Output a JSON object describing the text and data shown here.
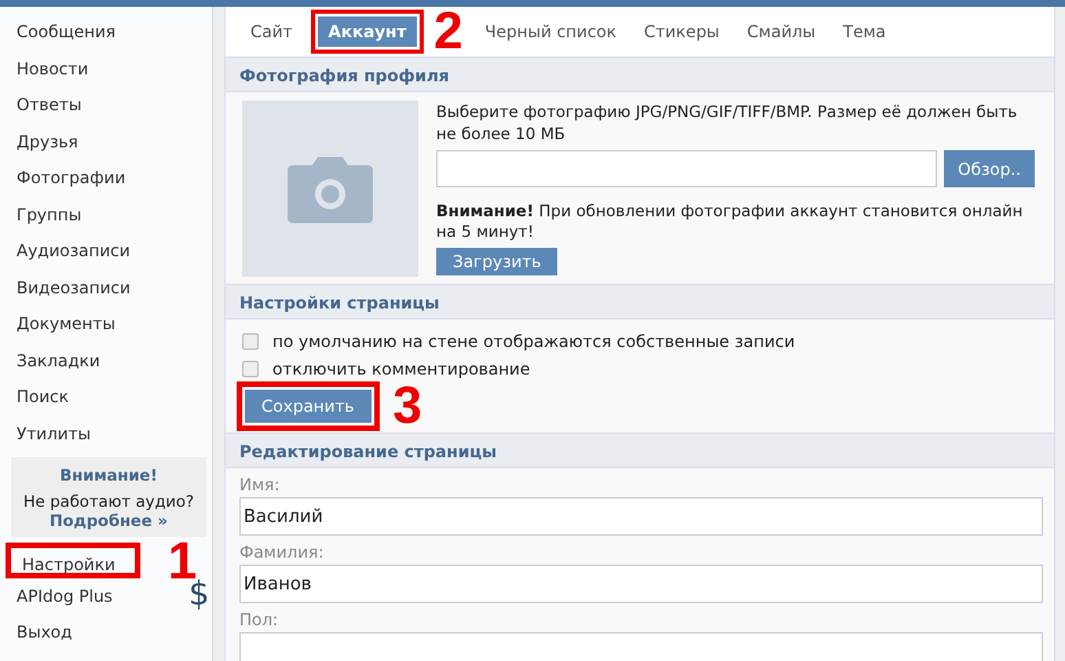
{
  "sidebar": {
    "items": [
      {
        "label": "Сообщения",
        "selected": false
      },
      {
        "label": "Новости",
        "selected": false
      },
      {
        "label": "Ответы",
        "selected": false
      },
      {
        "label": "Друзья",
        "selected": false
      },
      {
        "label": "Фотографии",
        "selected": false
      },
      {
        "label": "Группы",
        "selected": false
      },
      {
        "label": "Аудиозаписи",
        "selected": false
      },
      {
        "label": "Видеозаписи",
        "selected": false
      },
      {
        "label": "Документы",
        "selected": false
      },
      {
        "label": "Закладки",
        "selected": false
      },
      {
        "label": "Поиск",
        "selected": false
      },
      {
        "label": "Утилиты",
        "selected": false
      }
    ],
    "notice": {
      "title": "Внимание!",
      "text": "Не работают аудио?",
      "link": "Подробнее »"
    },
    "bottom_items": [
      {
        "label": "Настройки",
        "selected": true,
        "annotation": "1"
      },
      {
        "label": "APIdog Plus",
        "selected": false,
        "badge": "$"
      },
      {
        "label": "Выход",
        "selected": false
      }
    ]
  },
  "tabs": [
    {
      "label": "Сайт",
      "selected": false
    },
    {
      "label": "Аккаунт",
      "selected": true,
      "annotation": "2"
    },
    {
      "label": "Черный список",
      "selected": false
    },
    {
      "label": "Стикеры",
      "selected": false
    },
    {
      "label": "Смайлы",
      "selected": false
    },
    {
      "label": "Тема",
      "selected": false
    }
  ],
  "photo_section": {
    "title": "Фотография профиля",
    "hint": "Выберите фотографию JPG/PNG/GIF/TIFF/BMP. Размер её должен быть не более 10 МБ",
    "browse_button": "Обзор..",
    "warning": "**Внимание!** При обновлении фотографии аккаунт становится онлайн на 5 минут!",
    "upload_button": "Загрузить"
  },
  "settings_section": {
    "title": "Настройки страницы",
    "options": [
      {
        "label": "по умолчанию на стене отображаются собственные записи",
        "checked": false
      },
      {
        "label": "отключить комментирование",
        "checked": false
      }
    ],
    "save_button": "Сохранить",
    "save_annotation": "3"
  },
  "edit_section": {
    "title": "Редактирование страницы",
    "fields": [
      {
        "label": "Имя:",
        "value": "Василий",
        "kind": "input"
      },
      {
        "label": "Фамилия:",
        "value": "Иванов",
        "kind": "input"
      },
      {
        "label": "Пол:",
        "kind": "select"
      }
    ]
  }
}
